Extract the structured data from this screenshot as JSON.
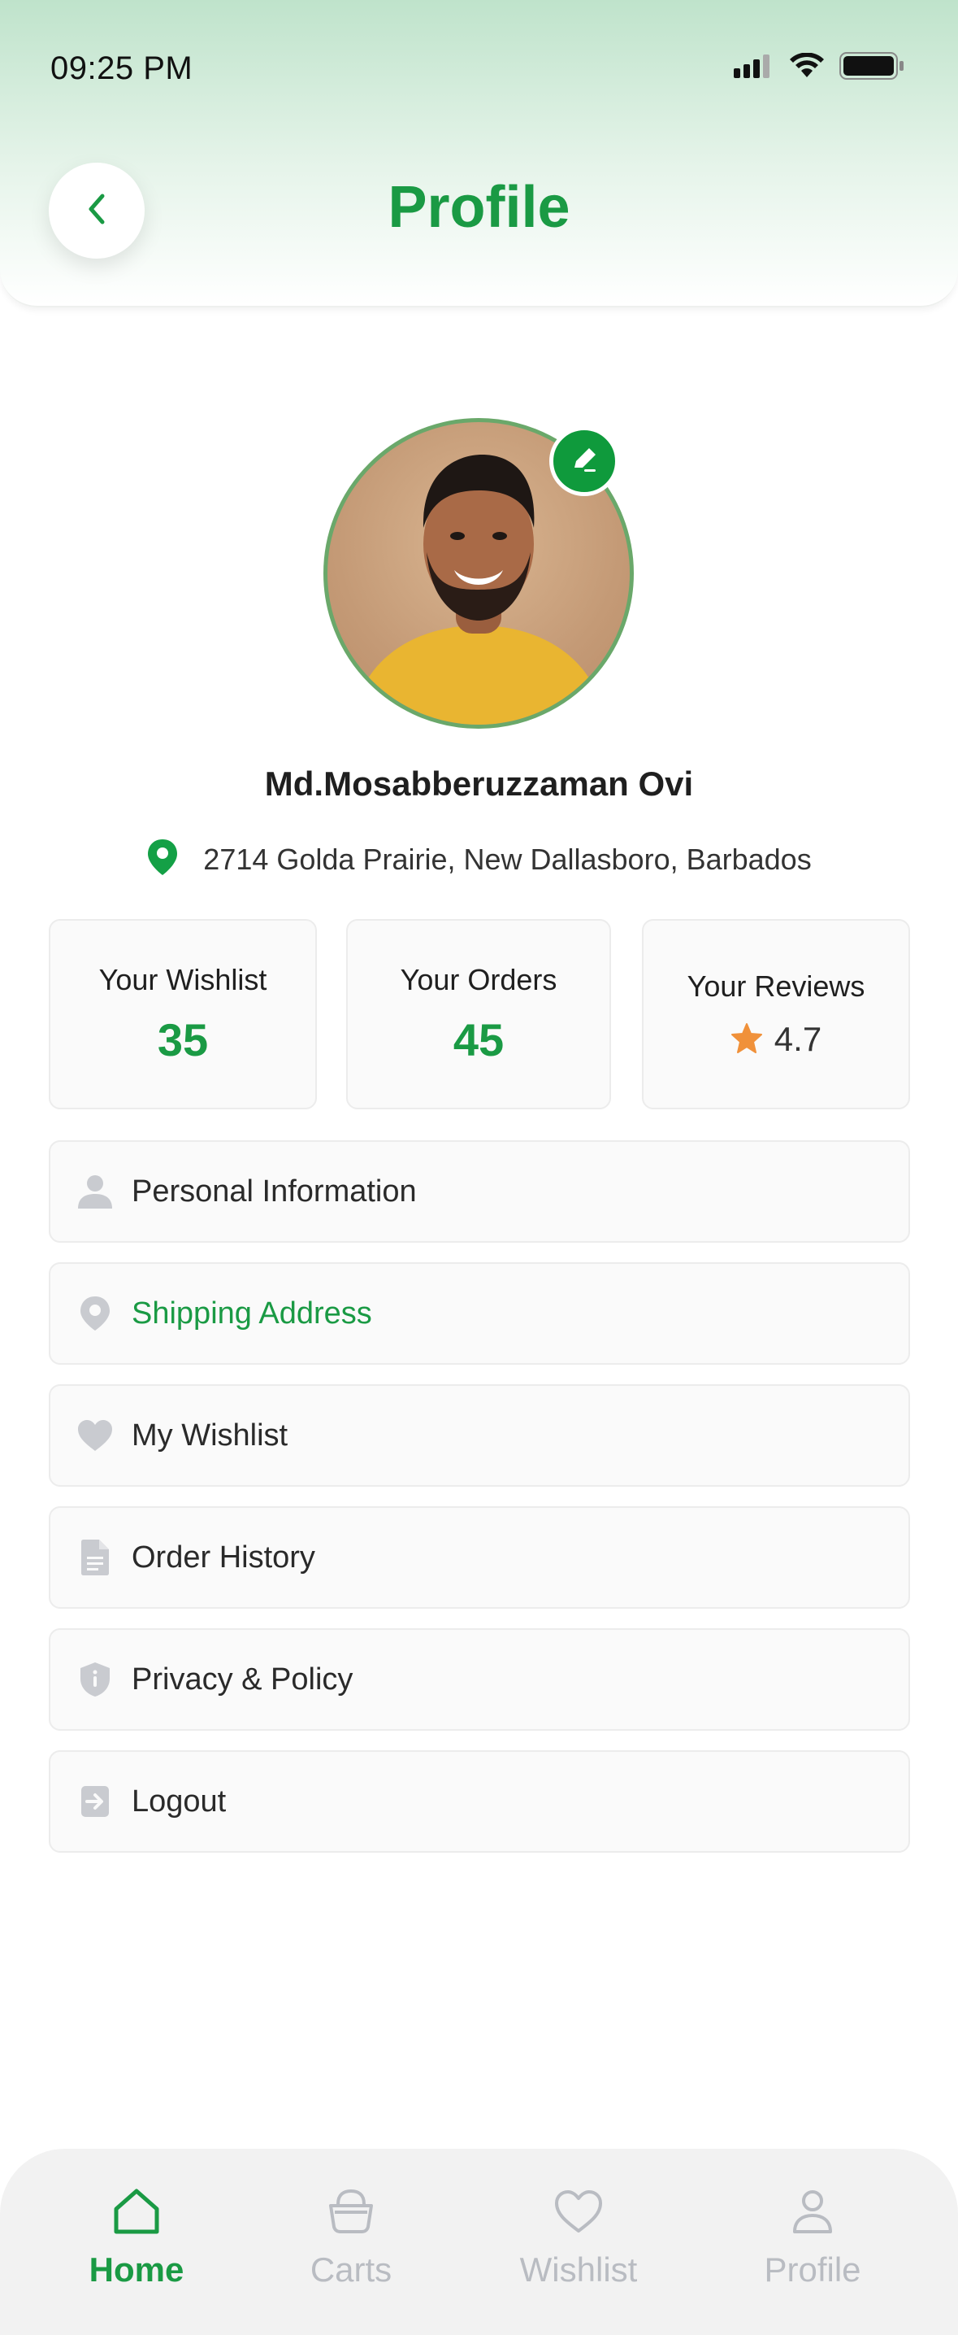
{
  "status_bar": {
    "time": "09:25 PM",
    "icons": [
      "signal-icon",
      "wifi-icon",
      "battery-icon"
    ]
  },
  "header": {
    "title": "Profile",
    "back_icon": "chevron-left-icon"
  },
  "profile": {
    "name": "Md.Mosabberuzzaman Ovi",
    "address": "2714 Golda Prairie, New Dallasboro, Barbados",
    "edit_icon": "pencil-icon"
  },
  "stats": [
    {
      "label": "Your Wishlist",
      "value": "35"
    },
    {
      "label": "Your Orders",
      "value": "45"
    },
    {
      "label": "Your Reviews",
      "value": "4.7"
    }
  ],
  "menu": [
    {
      "label": "Personal Information",
      "icon": "user-icon",
      "active": false
    },
    {
      "label": "Shipping Address",
      "icon": "location-pin-icon",
      "active": true
    },
    {
      "label": "My Wishlist",
      "icon": "heart-icon",
      "active": false
    },
    {
      "label": "Order History",
      "icon": "document-icon",
      "active": false
    },
    {
      "label": "Privacy & Policy",
      "icon": "shield-icon",
      "active": false
    },
    {
      "label": "Logout",
      "icon": "logout-icon",
      "active": false
    }
  ],
  "bottom_nav": [
    {
      "label": "Home",
      "icon": "home-icon",
      "active": true
    },
    {
      "label": "Carts",
      "icon": "basket-icon",
      "active": false
    },
    {
      "label": "Wishlist",
      "icon": "heart-outline-icon",
      "active": false
    },
    {
      "label": "Profile",
      "icon": "user-outline-icon",
      "active": false
    }
  ],
  "colors": {
    "accent": "#1a9a44",
    "star": "#f0913a",
    "inactive": "#b9bcc2"
  }
}
